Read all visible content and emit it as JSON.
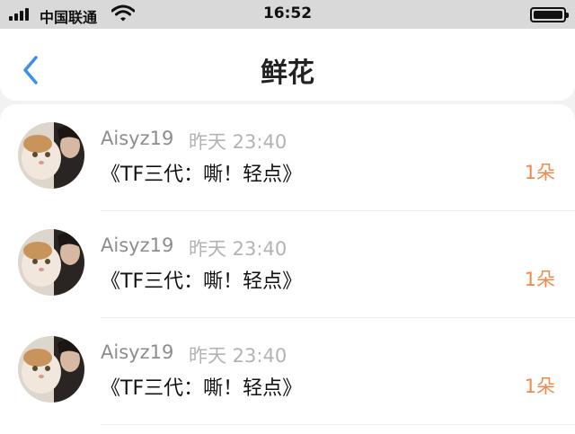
{
  "status_bar": {
    "carrier": "中国联通",
    "time": "16:52"
  },
  "header": {
    "title": "鲜花",
    "back_icon": "chevron-left-icon"
  },
  "colors": {
    "accent_blue": "#3d8fe8",
    "count_orange": "#f08a4b"
  },
  "records": [
    {
      "user": "Aisyz19",
      "time": "昨天 23:40",
      "gift": "《TF三代：嘶！轻点》",
      "count": "1朵"
    },
    {
      "user": "Aisyz19",
      "time": "昨天 23:40",
      "gift": "《TF三代：嘶！轻点》",
      "count": "1朵"
    },
    {
      "user": "Aisyz19",
      "time": "昨天 23:40",
      "gift": "《TF三代：嘶！轻点》",
      "count": "1朵"
    }
  ]
}
